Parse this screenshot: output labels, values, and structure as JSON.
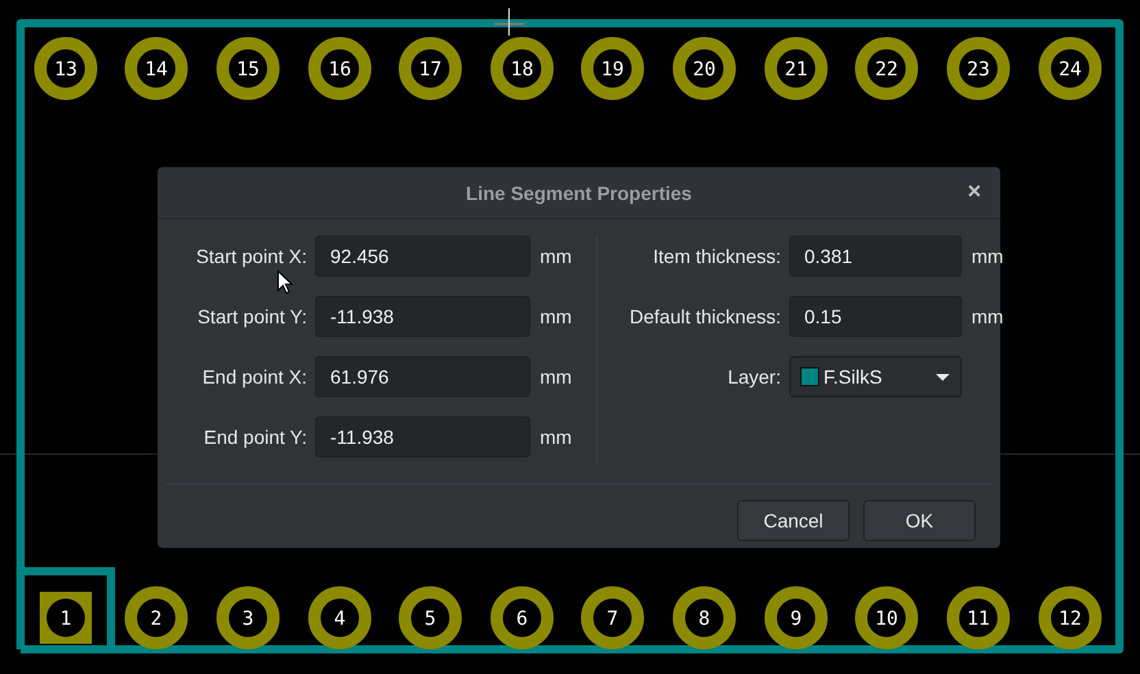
{
  "board": {
    "top_pads": [
      {
        "label": "13",
        "kind": "round"
      },
      {
        "label": "14",
        "kind": "round"
      },
      {
        "label": "15",
        "kind": "round"
      },
      {
        "label": "16",
        "kind": "round"
      },
      {
        "label": "17",
        "kind": "round"
      },
      {
        "label": "18",
        "kind": "round"
      },
      {
        "label": "19",
        "kind": "round"
      },
      {
        "label": "20",
        "kind": "round"
      },
      {
        "label": "21",
        "kind": "round"
      },
      {
        "label": "22",
        "kind": "round"
      },
      {
        "label": "23",
        "kind": "round"
      },
      {
        "label": "24",
        "kind": "round"
      }
    ],
    "bottom_pads": [
      {
        "label": "1",
        "kind": "square"
      },
      {
        "label": "2",
        "kind": "round"
      },
      {
        "label": "3",
        "kind": "round"
      },
      {
        "label": "4",
        "kind": "round"
      },
      {
        "label": "5",
        "kind": "round"
      },
      {
        "label": "6",
        "kind": "round"
      },
      {
        "label": "7",
        "kind": "round"
      },
      {
        "label": "8",
        "kind": "round"
      },
      {
        "label": "9",
        "kind": "round"
      },
      {
        "label": "10",
        "kind": "round"
      },
      {
        "label": "11",
        "kind": "round"
      },
      {
        "label": "12",
        "kind": "round"
      }
    ]
  },
  "dialog": {
    "title": "Line Segment Properties",
    "close": "×",
    "left_fields": [
      {
        "label": "Start point X:",
        "value": "92.456",
        "unit": "mm"
      },
      {
        "label": "Start point Y:",
        "value": "-11.938",
        "unit": "mm"
      },
      {
        "label": "End point X:",
        "value": "61.976",
        "unit": "mm"
      },
      {
        "label": "End point Y:",
        "value": "-11.938",
        "unit": "mm"
      }
    ],
    "right_fields": [
      {
        "label": "Item thickness:",
        "value": "0.381",
        "unit": "mm"
      },
      {
        "label": "Default thickness:",
        "value": "0.15",
        "unit": "mm"
      }
    ],
    "layer": {
      "label": "Layer:",
      "value": "F.SilkS",
      "color": "#008484"
    },
    "buttons": [
      "Cancel",
      "OK"
    ]
  }
}
